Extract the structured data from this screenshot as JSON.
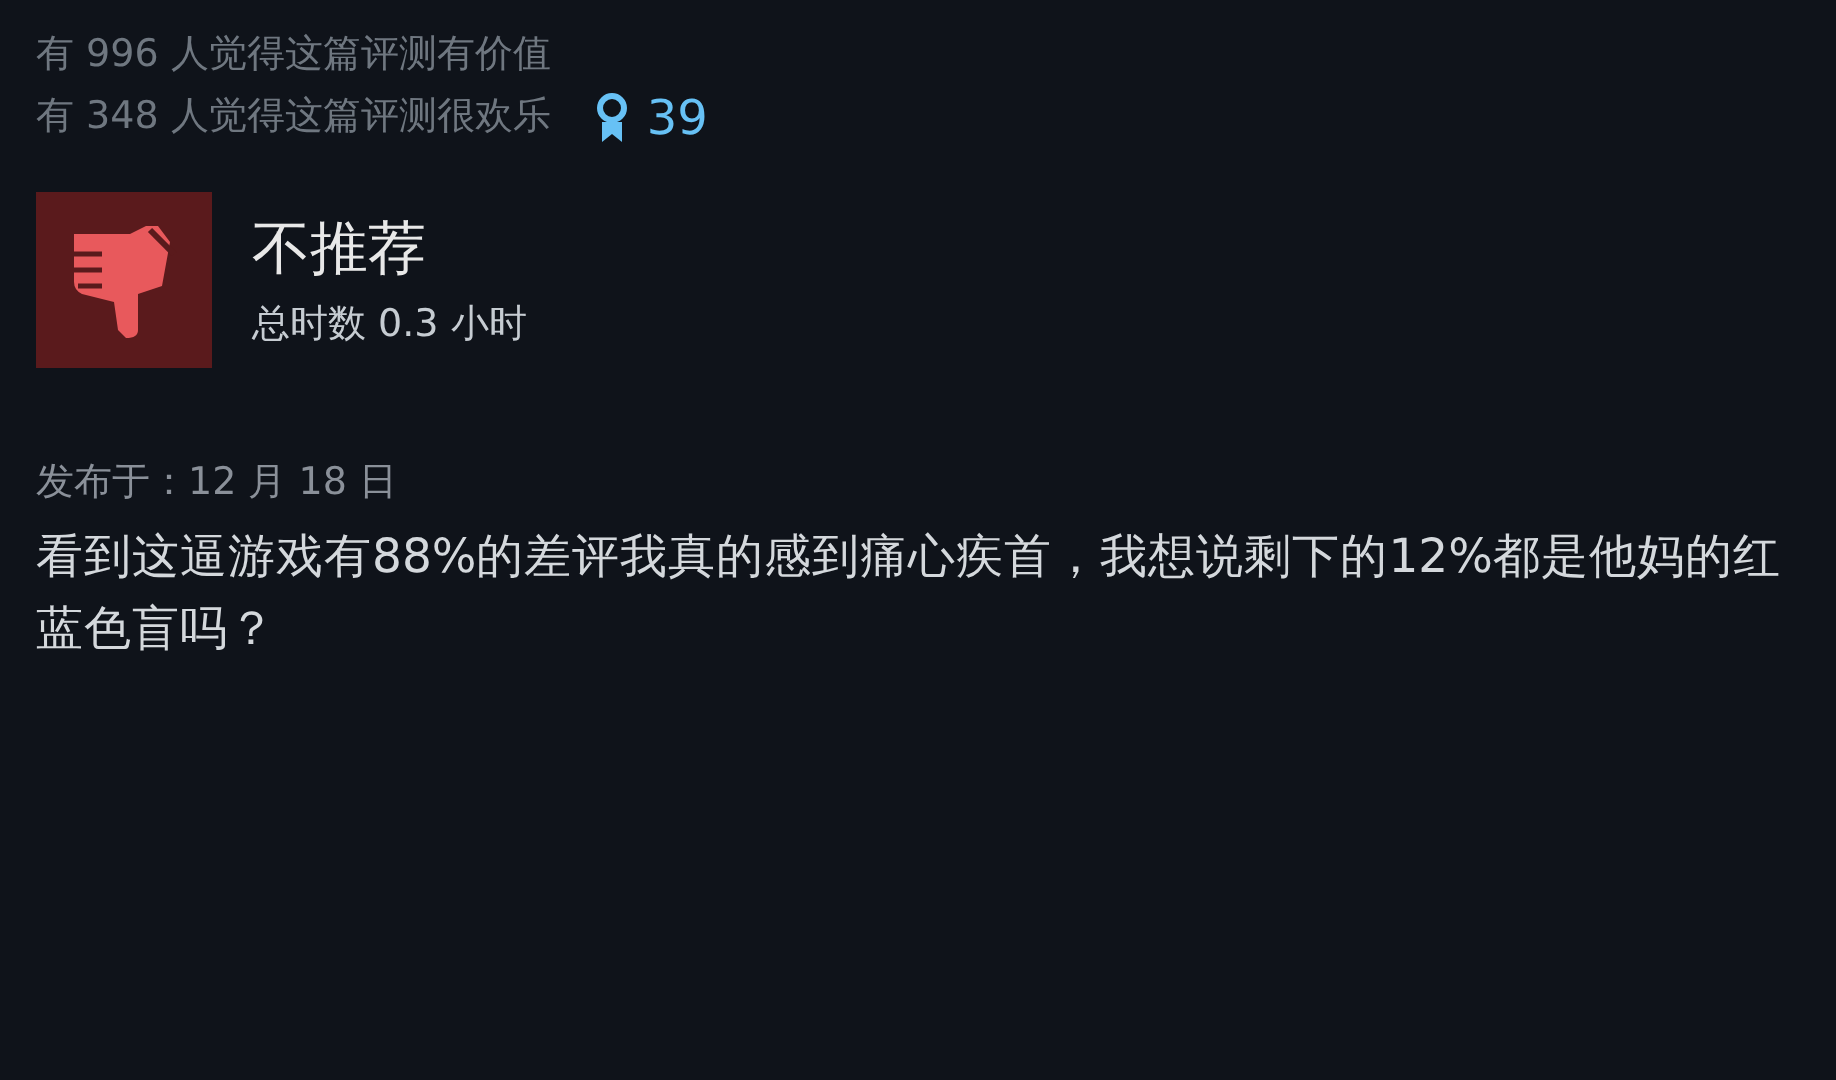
{
  "helpful_stats": [
    {
      "text": "有 996 人觉得这篇评测有价值"
    },
    {
      "text": "有 348 人觉得这篇评测很欢乐"
    }
  ],
  "awards": {
    "count": "39"
  },
  "verdict": {
    "kind": "not_recommended",
    "title": "不推荐",
    "playtime": "总时数 0.3 小时"
  },
  "posted": "发布于：12 月 18 日",
  "review_text": "看到这逼游戏有88%的差评我真的感到痛心疾首，我想说剩下的12%都是他妈的红蓝色盲吗？"
}
